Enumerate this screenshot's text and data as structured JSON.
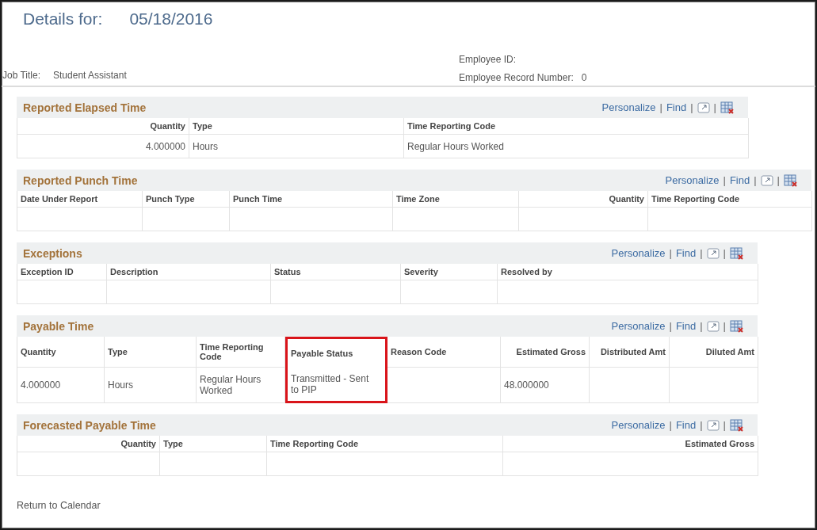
{
  "header": {
    "title": "Details for:",
    "date": "05/18/2016",
    "job_title": {
      "label": "Job Title:",
      "value": "Student Assistant"
    },
    "employee_fields": [
      {
        "label": "Employee ID:"
      },
      {
        "label": "Employee Record Number:",
        "value": "0"
      }
    ]
  },
  "grids": [
    {
      "title": "Reported Elapsed Time",
      "links": [
        "Personalize",
        "|",
        "Find",
        "|"
      ],
      "columns": [
        {
          "label": "Quantity"
        },
        {
          "label": "Type"
        },
        {
          "label": "Time Reporting Code"
        }
      ],
      "rows": [
        {
          "cells": [
            "4.000000",
            "Hours",
            "Regular Hours Worked"
          ]
        }
      ]
    },
    {
      "title": "Reported Punch Time",
      "links": [
        "Personalize",
        "|",
        "Find",
        "|"
      ],
      "columns": [
        {
          "label": "Date Under Report"
        },
        {
          "label": "Punch Type"
        },
        {
          "label": "Punch Time"
        },
        {
          "label": "Time Zone"
        },
        {
          "label": "Quantity"
        },
        {
          "label": "Time Reporting Code"
        }
      ]
    },
    {
      "title": "Exceptions",
      "links": [
        "Personalize",
        "|",
        "Find",
        "|"
      ],
      "columns": [
        {
          "label": "Exception ID"
        },
        {
          "label": "Description"
        },
        {
          "label": "Status"
        },
        {
          "label": "Severity"
        },
        {
          "label": "Resolved by"
        }
      ]
    },
    {
      "title": "Payable Time",
      "links": [
        "Personalize",
        "|",
        "Find",
        "|"
      ],
      "columns": [
        {
          "label": "Quantity"
        },
        {
          "label": "Type"
        },
        {
          "label": "Time Reporting Code"
        },
        {
          "label": "Payable Status",
          "highlighted": true
        },
        {
          "label": "Reason Code"
        },
        {
          "label": "Estimated Gross"
        },
        {
          "label": "Distributed Amt"
        },
        {
          "label": "Diluted Amt"
        }
      ],
      "rows": [
        {
          "cells": [
            "4.000000",
            "Hours",
            "Regular Hours Worked",
            "Transmitted - Sent to PIP",
            "",
            "48.000000",
            "",
            ""
          ]
        }
      ]
    },
    {
      "title": "Forecasted Payable Time",
      "links": [
        "Personalize",
        "|",
        "Find",
        "|"
      ],
      "columns": [
        {
          "label": "Quantity"
        },
        {
          "label": "Type"
        },
        {
          "label": "Time Reporting Code"
        },
        {
          "label": "Estimated Gross"
        }
      ]
    }
  ],
  "footer_link": "Return to Calendar"
}
